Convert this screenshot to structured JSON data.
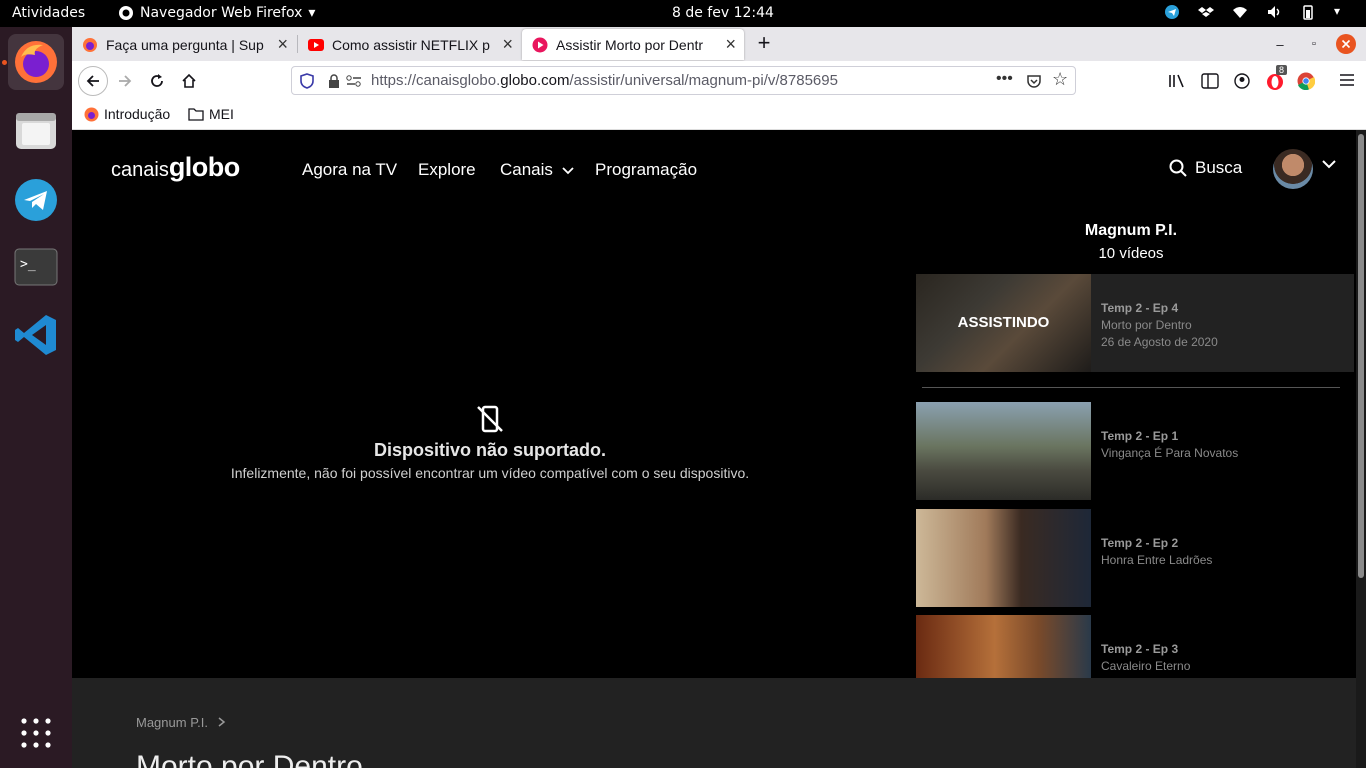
{
  "system": {
    "activities": "Atividades",
    "app_name": "Navegador Web Firefox",
    "clock": "8 de fev  12:44"
  },
  "tabs": [
    {
      "title": "Faça uma pergunta | Sup"
    },
    {
      "title": "Como assistir NETFLIX p"
    },
    {
      "title": "Assistir Morto por Dentr"
    }
  ],
  "url": {
    "prefix": "https://canaisglobo.",
    "domain": "globo.com",
    "path": "/assistir/universal/magnum-pi/v/8785695"
  },
  "bookmarks": [
    {
      "label": "Introdução"
    },
    {
      "label": "MEI"
    }
  ],
  "extension_badge": "8",
  "site": {
    "logo_light": "canais",
    "logo_bold": "globo",
    "nav": [
      "Agora na TV",
      "Explore",
      "Canais",
      "Programação"
    ],
    "search": "Busca"
  },
  "player": {
    "error_title": "Dispositivo não suportado.",
    "error_sub": "Infelizmente, não foi possível encontrar um vídeo compatível com o seu dispositivo."
  },
  "playlist": {
    "title": "Magnum P.I.",
    "count": "10 vídeos",
    "current_label": "ASSISTINDO",
    "episodes": [
      {
        "ep": "Temp 2 - Ep 4",
        "name": "Morto por Dentro",
        "date": "26 de Agosto de 2020"
      },
      {
        "ep": "Temp 2 - Ep 1",
        "name": "Vingança É Para Novatos"
      },
      {
        "ep": "Temp 2 - Ep 2",
        "name": "Honra Entre Ladrões"
      },
      {
        "ep": "Temp 2 - Ep 3",
        "name": "Cavaleiro Eterno"
      }
    ]
  },
  "details": {
    "breadcrumb": "Magnum P.I.",
    "title": "Morto por Dentro"
  }
}
